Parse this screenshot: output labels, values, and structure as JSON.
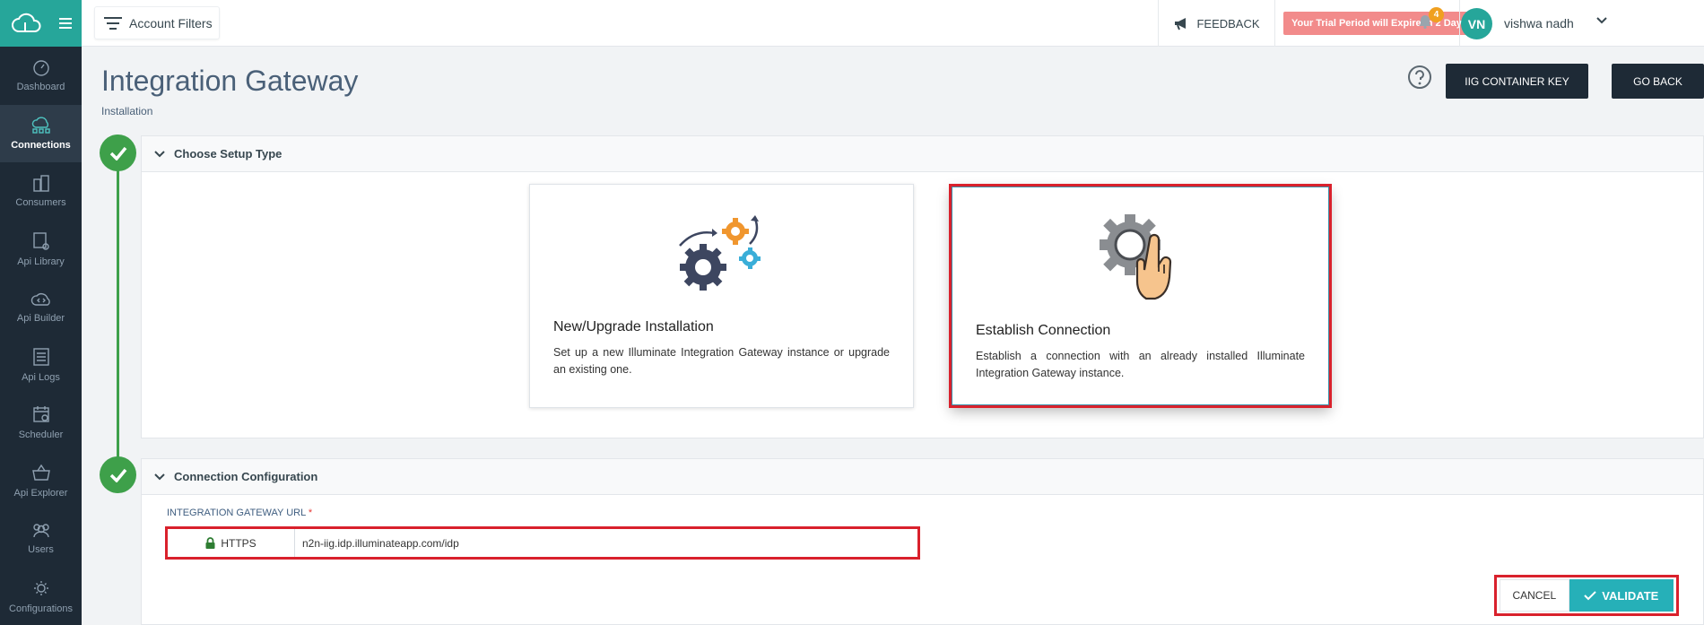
{
  "sidebar": {
    "items": [
      {
        "label": "Dashboard",
        "icon": "speedometer-icon"
      },
      {
        "label": "Connections",
        "icon": "cloud-network-icon",
        "active": true
      },
      {
        "label": "Consumers",
        "icon": "buildings-icon"
      },
      {
        "label": "Api Library",
        "icon": "api-book-icon"
      },
      {
        "label": "Api Builder",
        "icon": "cloud-code-icon"
      },
      {
        "label": "Api Logs",
        "icon": "log-list-icon"
      },
      {
        "label": "Scheduler",
        "icon": "calendar-icon"
      },
      {
        "label": "Api Explorer",
        "icon": "explorer-basket-icon"
      },
      {
        "label": "Users",
        "icon": "users-icon"
      },
      {
        "label": "Configurations",
        "icon": "gear-cloud-icon"
      }
    ]
  },
  "topbar": {
    "account_filters": "Account Filters",
    "feedback": "FEEDBACK",
    "trial_notice": "Your Trial Period will Expire in 2 Days",
    "notification_count": "4",
    "avatar_initials": "VN",
    "username": "vishwa nadh"
  },
  "page": {
    "title": "Integration Gateway",
    "subtitle": "Installation",
    "iig_key_button": "IIG CONTAINER KEY",
    "go_back_button": "GO BACK"
  },
  "setup_type": {
    "heading": "Choose Setup Type",
    "options": [
      {
        "title": "New/Upgrade Installation",
        "description": "Set up a new Illuminate Integration Gateway instance or upgrade an existing one."
      },
      {
        "title": "Establish Connection",
        "description": "Establish a connection with an already installed Illuminate Integration Gateway instance.",
        "selected": true
      }
    ]
  },
  "connection_config": {
    "heading": "Connection Configuration",
    "url_label": "INTEGRATION GATEWAY URL",
    "required_mark": "*",
    "protocol": "HTTPS",
    "url_value": "n2n-iig.idp.illuminateapp.com/idp",
    "cancel_button": "CANCEL",
    "validate_button": "VALIDATE"
  },
  "colors": {
    "sidebar_bg": "#1e2a36",
    "brand_teal": "#26a69a",
    "step_green": "#3ea04a",
    "highlight_red": "#d9212c",
    "validate_teal": "#26b0b8",
    "trial_pink": "#f28b8b"
  }
}
